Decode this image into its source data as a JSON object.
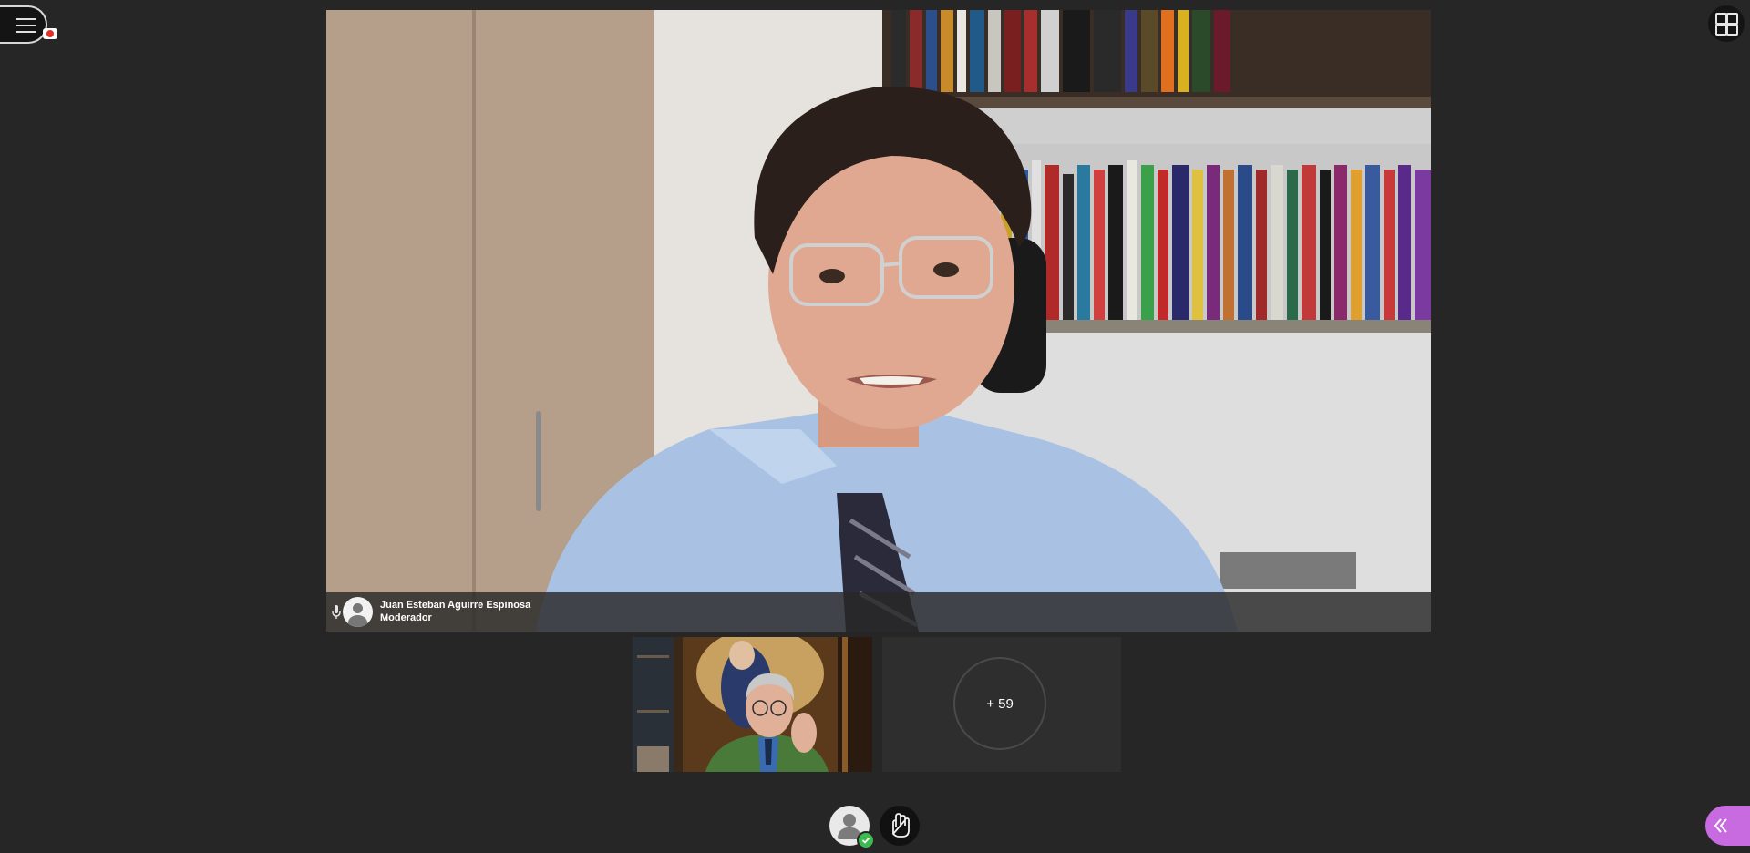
{
  "main_video": {
    "participant_name": "Juan Esteban Aguirre Espinosa",
    "participant_role": "Moderador"
  },
  "tiles": {
    "more_count_label": "+ 59"
  },
  "icons": {
    "menu": "menu-icon",
    "recording": "recording-icon",
    "layout": "grid-layout-icon",
    "mic": "microphone-icon",
    "avatar": "avatar-icon",
    "profile": "profile-icon",
    "status_check": "check-icon",
    "raise_hand": "raise-hand-icon",
    "collapse": "chevron-double-left-icon"
  },
  "colors": {
    "background": "#262626",
    "accent_purple": "#c86ae0",
    "status_green": "#3dbb4e",
    "recording_red": "#e0302a"
  }
}
